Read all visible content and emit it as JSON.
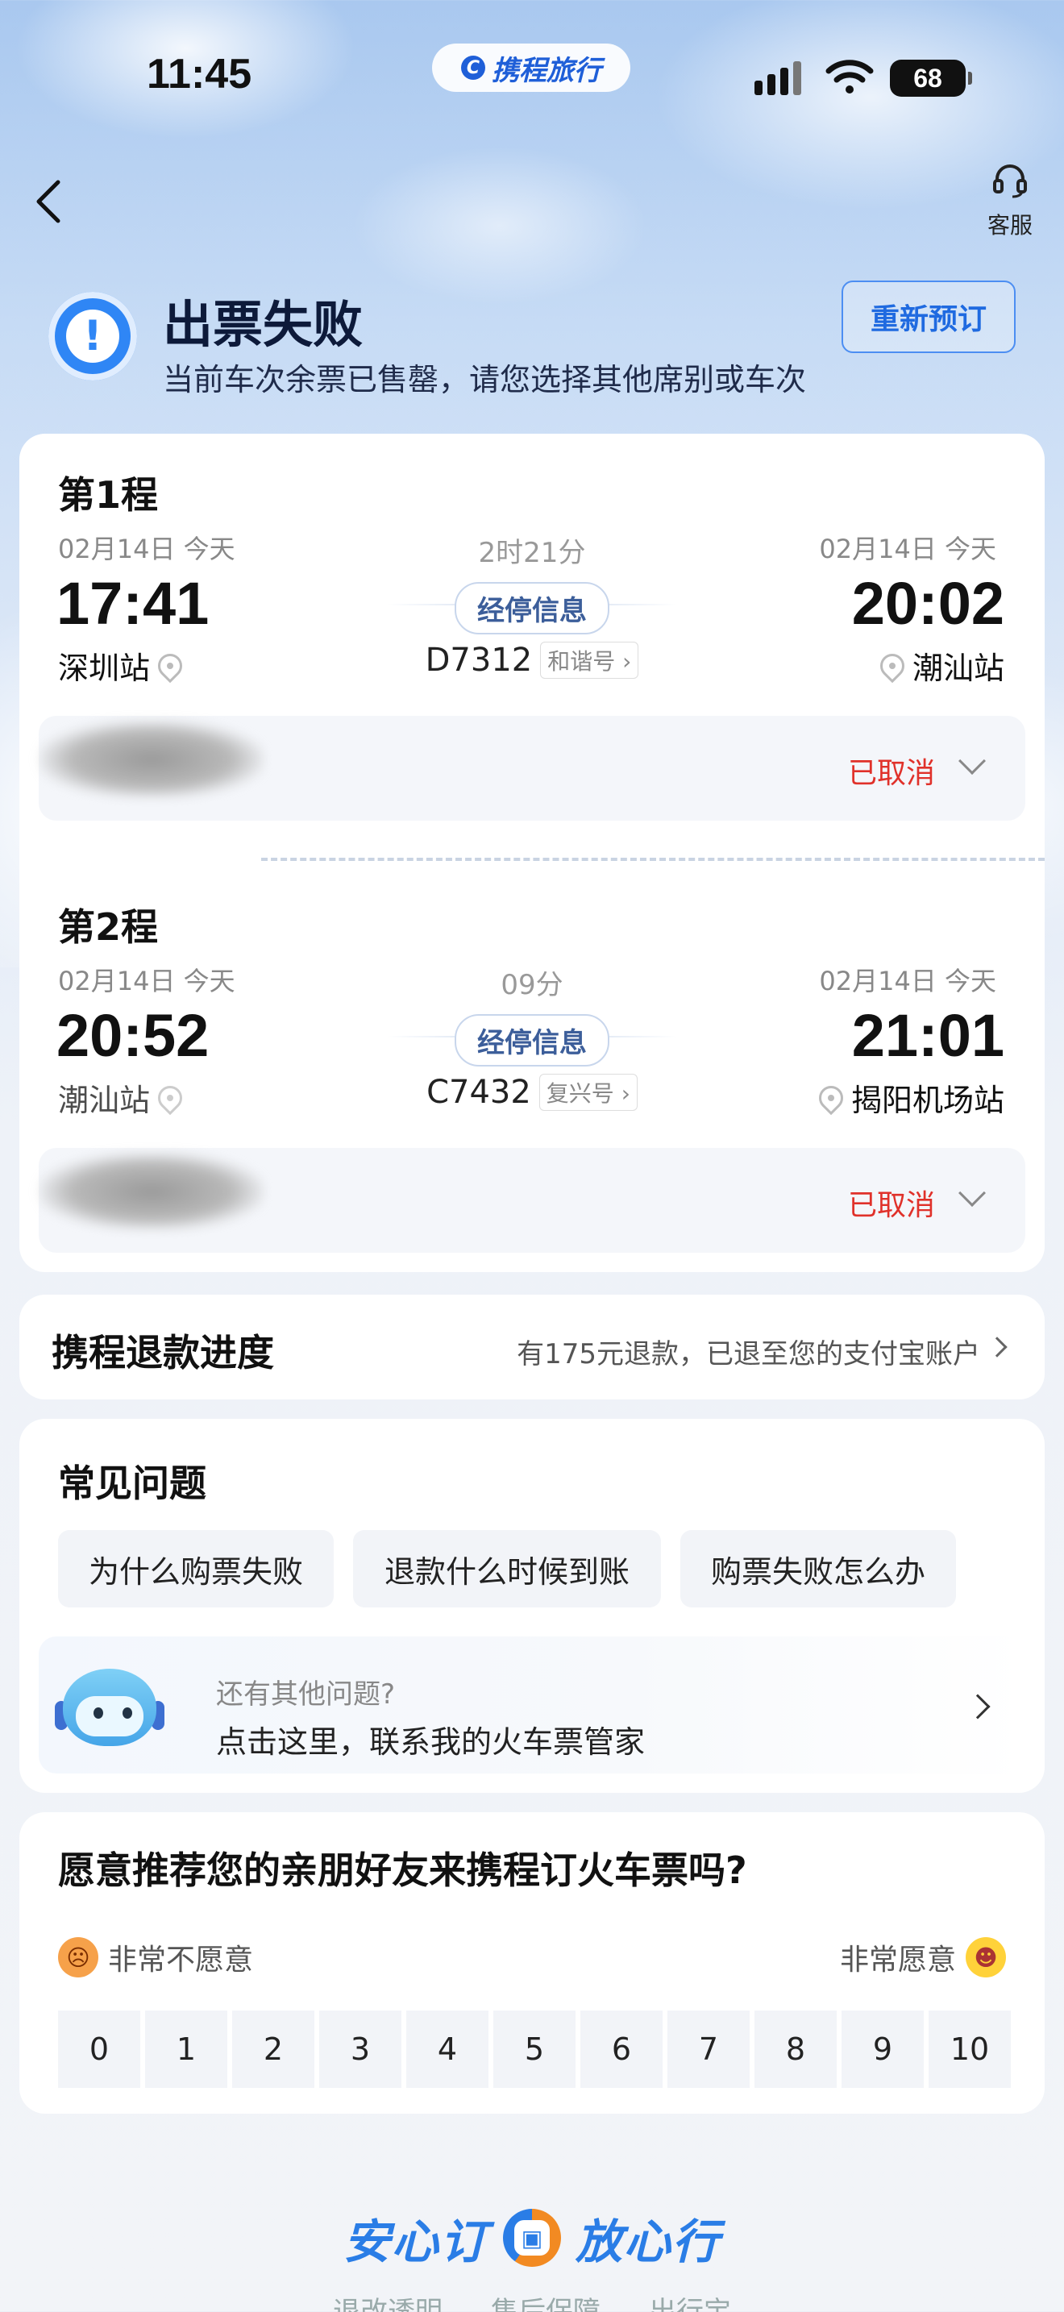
{
  "status_bar": {
    "time": "11:45",
    "app_name": "携程旅行",
    "battery": "68"
  },
  "header": {
    "service_label": "客服"
  },
  "result": {
    "title": "出票失败",
    "subtitle": "当前车次余票已售罄，请您选择其他席别或车次",
    "rebook_label": "重新预订"
  },
  "trips": [
    {
      "title": "第1程",
      "dep_date": "02月14日 今天",
      "arr_date": "02月14日 今天",
      "duration": "2时21分",
      "dep_time": "17:41",
      "arr_time": "20:02",
      "dep_station": "深圳站",
      "arr_station": "潮汕站",
      "stops_label": "经停信息",
      "train_no": "D7312",
      "train_type": "和谐号",
      "status": "已取消"
    },
    {
      "title": "第2程",
      "dep_date": "02月14日 今天",
      "arr_date": "02月14日 今天",
      "duration": "09分",
      "dep_time": "20:52",
      "arr_time": "21:01",
      "dep_station": "潮汕站",
      "arr_station": "揭阳机场站",
      "stops_label": "经停信息",
      "train_no": "C7432",
      "train_type": "复兴号",
      "status": "已取消"
    }
  ],
  "refund": {
    "title": "携程退款进度",
    "info": "有175元退款，已退至您的支付宝账户"
  },
  "faq": {
    "title": "常见问题",
    "chips": [
      "为什么购票失败",
      "退款什么时候到账",
      "购票失败怎么办"
    ],
    "help_hint": "还有其他问题?",
    "help_action": "点击这里，联系我的火车票管家"
  },
  "nps": {
    "question": "愿意推荐您的亲朋好友来携程订火车票吗?",
    "low_label": "非常不愿意",
    "high_label": "非常愿意",
    "scores": [
      "0",
      "1",
      "2",
      "3",
      "4",
      "5",
      "6",
      "7",
      "8",
      "9",
      "10"
    ]
  },
  "footer": {
    "slogan_left": "安心订",
    "slogan_right": "放心行",
    "links": [
      "退改透明",
      "售后保障",
      "出行宝"
    ]
  }
}
